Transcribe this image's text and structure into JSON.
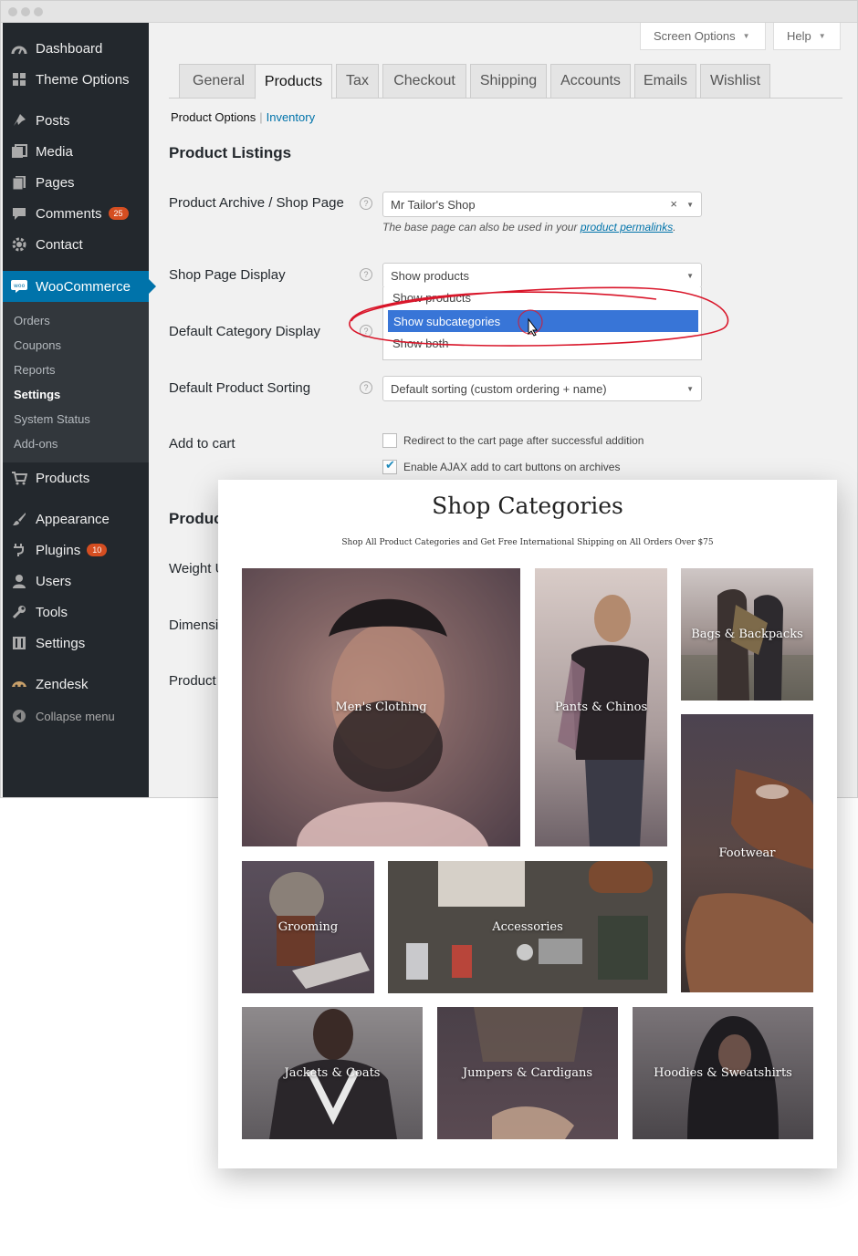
{
  "admin_menu": {
    "items": [
      {
        "label": "Dashboard",
        "icon": "dashboard-icon"
      },
      {
        "label": "Theme Options",
        "icon": "grid-icon"
      },
      {
        "label": "Posts",
        "icon": "pin-icon"
      },
      {
        "label": "Media",
        "icon": "media-icon"
      },
      {
        "label": "Pages",
        "icon": "pages-icon"
      },
      {
        "label": "Comments",
        "icon": "comment-icon",
        "badge": "25"
      },
      {
        "label": "Contact",
        "icon": "gear-icon"
      },
      {
        "label": "WooCommerce",
        "icon": "woo-icon"
      },
      {
        "label": "Products",
        "icon": "cart-icon"
      },
      {
        "label": "Appearance",
        "icon": "brush-icon"
      },
      {
        "label": "Plugins",
        "icon": "plug-icon",
        "badge": "10"
      },
      {
        "label": "Users",
        "icon": "user-icon"
      },
      {
        "label": "Tools",
        "icon": "wrench-icon"
      },
      {
        "label": "Settings",
        "icon": "settings-icon"
      },
      {
        "label": "Zendesk",
        "icon": "zendesk-icon"
      },
      {
        "label": "Collapse menu",
        "icon": "collapse-icon"
      }
    ],
    "woo_submenu": [
      "Orders",
      "Coupons",
      "Reports",
      "Settings",
      "System Status",
      "Add-ons"
    ],
    "woo_submenu_current": "Settings"
  },
  "top_buttons": {
    "screen_options": "Screen Options",
    "help": "Help"
  },
  "tabs": [
    "General",
    "Products",
    "Tax",
    "Checkout",
    "Shipping",
    "Accounts",
    "Emails",
    "Wishlist"
  ],
  "active_tab": "Products",
  "sublinks": {
    "current": "Product Options",
    "separator": "|",
    "other": "Inventory"
  },
  "section_title": "Product Listings",
  "fields": {
    "shop_page": {
      "label": "Product Archive / Shop Page",
      "value": "Mr Tailor's Shop",
      "clear": "×",
      "desc_prefix": "The base page can also be used in your ",
      "desc_link": "product permalinks",
      "desc_suffix": "."
    },
    "shop_display": {
      "label": "Shop Page Display",
      "value": "Show products",
      "options": [
        "Show products",
        "Show subcategories",
        "Show both"
      ],
      "highlighted": "Show subcategories"
    },
    "category_display": {
      "label": "Default Category Display"
    },
    "sorting": {
      "label": "Default Product Sorting",
      "value": "Default sorting (custom ordering + name)"
    },
    "add_to_cart": {
      "label": "Add to cart",
      "options": [
        {
          "label": "Redirect to the cart page after successful addition",
          "checked": false
        },
        {
          "label": "Enable AJAX add to cart buttons on archives",
          "checked": true
        }
      ]
    }
  },
  "partial_labels": [
    "Produc",
    "Weight U",
    "Dimensi",
    "Product"
  ],
  "shop": {
    "title": "Shop Categories",
    "subtitle": "Shop All Product Categories and Get Free International Shipping on All Orders Over $75",
    "categories": [
      "Men's Clothing",
      "Pants & Chinos",
      "Bags & Backpacks",
      "Footwear",
      "Grooming",
      "Accessories",
      "Jackets & Coats",
      "Jumpers & Cardigans",
      "Hoodies & Sweatshirts"
    ]
  },
  "colors": {
    "sidebar": "#23282d",
    "accent": "#0073aa",
    "highlight": "#3875d7",
    "annotation": "#d9162a"
  }
}
